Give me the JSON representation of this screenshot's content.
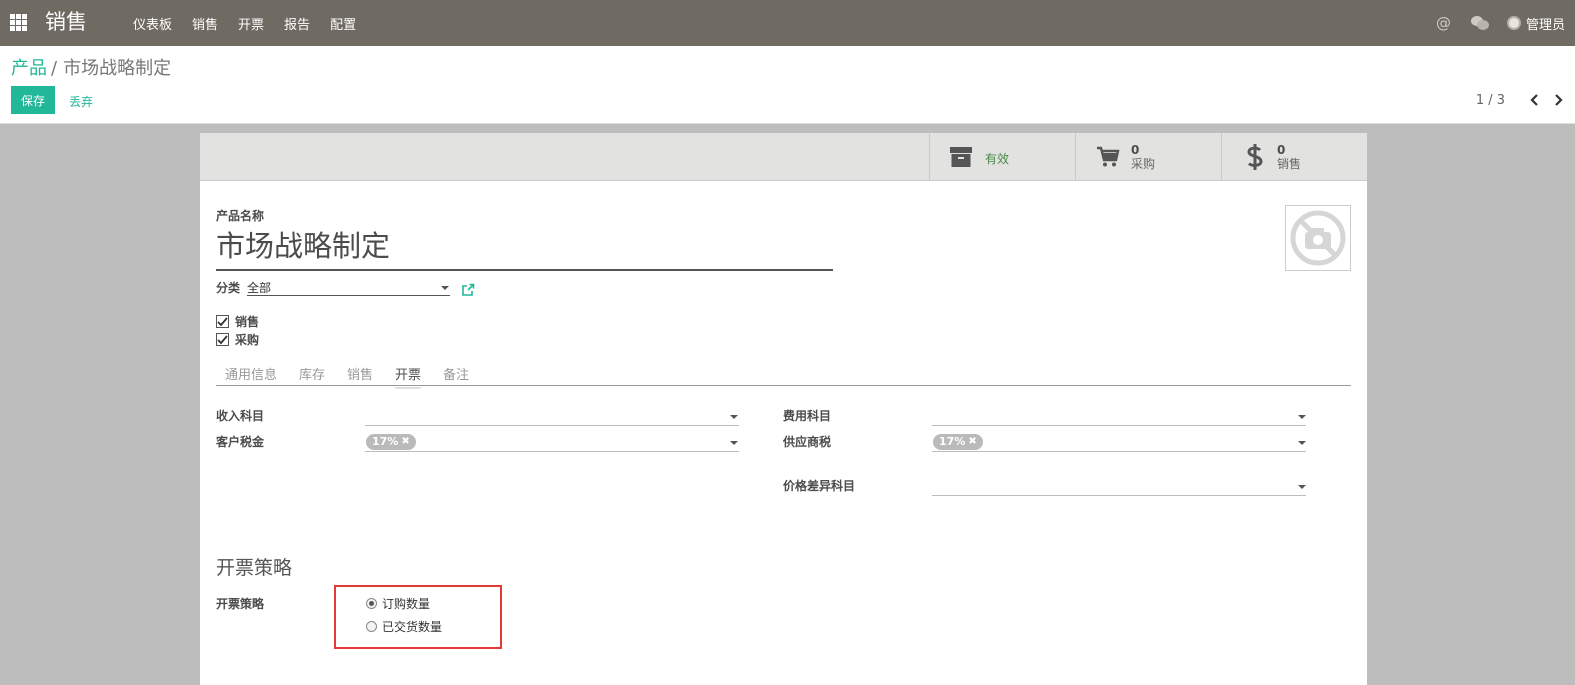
{
  "navbar": {
    "brand": "销售",
    "menu": [
      "仪表板",
      "销售",
      "开票",
      "报告",
      "配置"
    ],
    "at_symbol": "@",
    "user_name": "管理员"
  },
  "breadcrumb": {
    "parent": "产品",
    "separator": "/",
    "current": "市场战略制定"
  },
  "actions": {
    "save_label": "保存",
    "discard_label": "丢弃"
  },
  "pager": {
    "value": "1 / 3"
  },
  "stat_buttons": {
    "active_label": "有效",
    "purchase_count": "0",
    "purchase_label": "采购",
    "sales_count": "0",
    "sales_label": "销售"
  },
  "product": {
    "name_label": "产品名称",
    "name": "市场战略制定",
    "category_label": "分类",
    "category_value": "全部",
    "can_be_sold_label": "销售",
    "can_be_purchased_label": "采购"
  },
  "tabs": [
    "通用信息",
    "库存",
    "销售",
    "开票",
    "备注"
  ],
  "invoicing": {
    "income_account_label": "收入科目",
    "customer_taxes_label": "客户税金",
    "customer_tax_tag": "17%",
    "expense_account_label": "费用科目",
    "vendor_taxes_label": "供应商税",
    "vendor_tax_tag": "17%",
    "price_diff_label": "价格差异科目",
    "policy_section_title": "开票策略",
    "policy_label": "开票策略",
    "policy_options": [
      "订购数量",
      "已交货数量"
    ]
  },
  "colors": {
    "navbar": "#6f6a62",
    "accent": "#21b799",
    "highlight_box": "#e53935"
  }
}
